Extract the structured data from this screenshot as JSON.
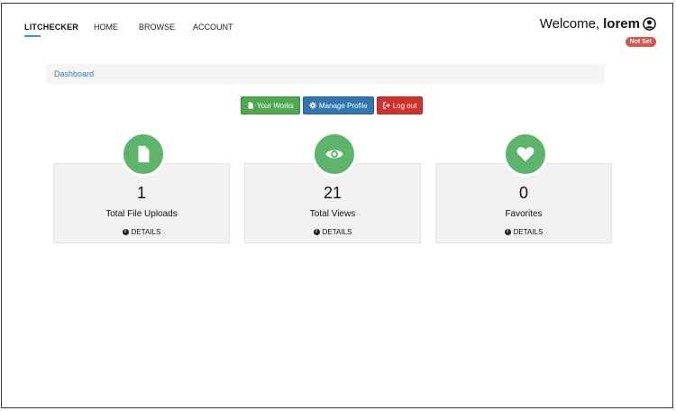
{
  "nav": {
    "brand": "LITCHECKER",
    "links": [
      "HOME",
      "BROWSE",
      "ACCOUNT"
    ]
  },
  "user": {
    "welcome_prefix": "Welcome,",
    "name": "lorem",
    "status_badge": "Not Set"
  },
  "breadcrumb": {
    "current": "Dashboard"
  },
  "actions": {
    "your_works": "Your Works",
    "manage_profile": "Manage Profile",
    "log_out": "Log out"
  },
  "stats": [
    {
      "icon": "file-icon",
      "value": "1",
      "label": "Total File Uploads",
      "details": "DETAILS"
    },
    {
      "icon": "eye-icon",
      "value": "21",
      "label": "Total Views",
      "details": "DETAILS"
    },
    {
      "icon": "heart-icon",
      "value": "0",
      "label": "Favorites",
      "details": "DETAILS"
    }
  ],
  "colors": {
    "accent_green": "#5cb56a",
    "button_green": "#4fa84f",
    "button_blue": "#3276b1",
    "button_red": "#d2322d",
    "badge_red": "#d9534f",
    "link_blue": "#337ab7"
  }
}
